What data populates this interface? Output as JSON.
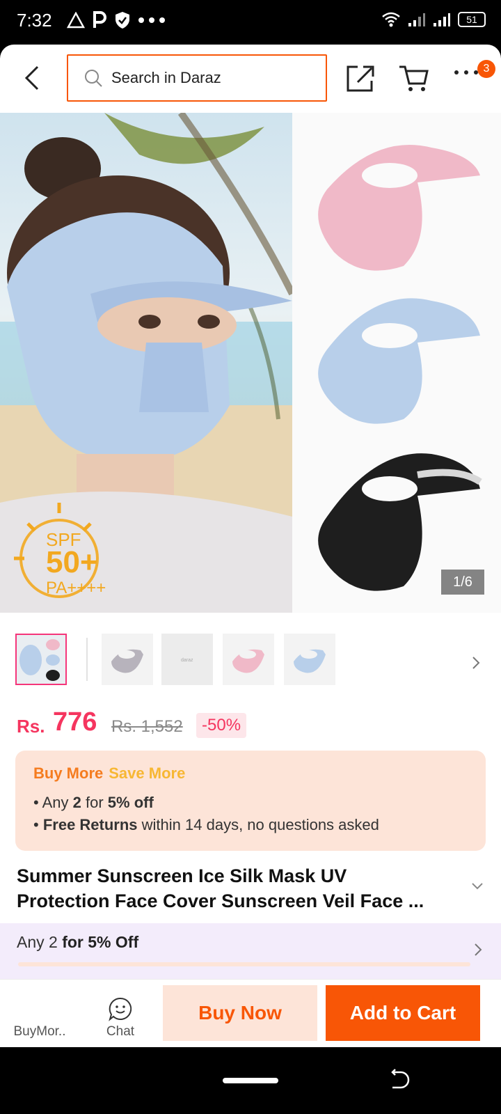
{
  "status_bar": {
    "time": "7:32",
    "battery": "51"
  },
  "header": {
    "search_placeholder": "Search in Daraz",
    "cart_badge": "3"
  },
  "gallery": {
    "counter": "1/6",
    "badge_spf": "SPF",
    "badge_value": "50+",
    "badge_pa": "PA++++",
    "thumbnails": [
      "thumb-1",
      "thumb-2",
      "thumb-3",
      "thumb-4",
      "thumb-5"
    ],
    "thumbnail_caption": "daraz"
  },
  "price": {
    "currency": "Rs.",
    "current": "776",
    "original": "Rs. 1,552",
    "discount": "-50%"
  },
  "promo": {
    "title_a": "Buy More",
    "title_b": "Save More",
    "line1_pre": "Any ",
    "line1_bold1": "2",
    "line1_mid": " for ",
    "line1_bold2": "5% off",
    "line2_bold": "Free Returns",
    "line2_rest": " within 14 days, no questions asked"
  },
  "product": {
    "title_line1": "Summer Sunscreen Ice Silk Mask UV",
    "title_line2": "Protection Face Cover Sunscreen Veil Face ..."
  },
  "bundle": {
    "text_pre": "Any 2 ",
    "text_bold": "for 5% Off"
  },
  "action_bar": {
    "buymore_label": "BuyMor..",
    "chat_label": "Chat",
    "buy_now": "Buy Now",
    "add_to_cart": "Add to Cart"
  },
  "colors": {
    "accent": "#f85606",
    "price": "#f5355f",
    "promo_bg": "#fde4d8",
    "bundle_bg": "#f3ecfb"
  }
}
